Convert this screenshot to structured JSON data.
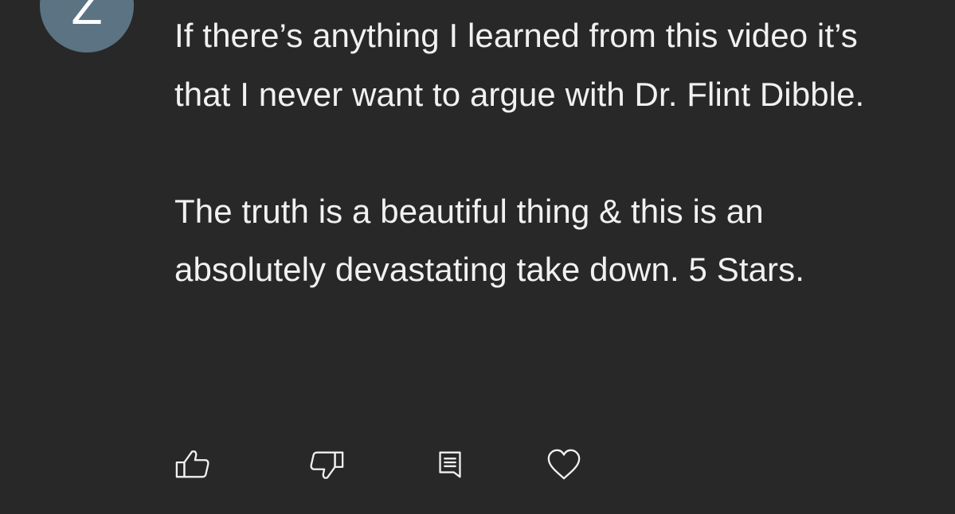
{
  "author": {
    "avatar_letter": "Z",
    "avatar_color": "#5b7383"
  },
  "comment": {
    "paragraphs": [
      "If there’s anything I learned from this video it’s that I never want to argue with Dr. Flint Dibble.",
      "The truth is a beautiful thing & this is an absolutely devastating take down. 5 Stars."
    ]
  },
  "actions": {
    "like_icon": "thumbs-up-icon",
    "dislike_icon": "thumbs-down-icon",
    "reply_icon": "reply-comment-icon",
    "heart_icon": "heart-icon"
  },
  "colors": {
    "background": "#282828",
    "text": "#f1f1f1"
  }
}
